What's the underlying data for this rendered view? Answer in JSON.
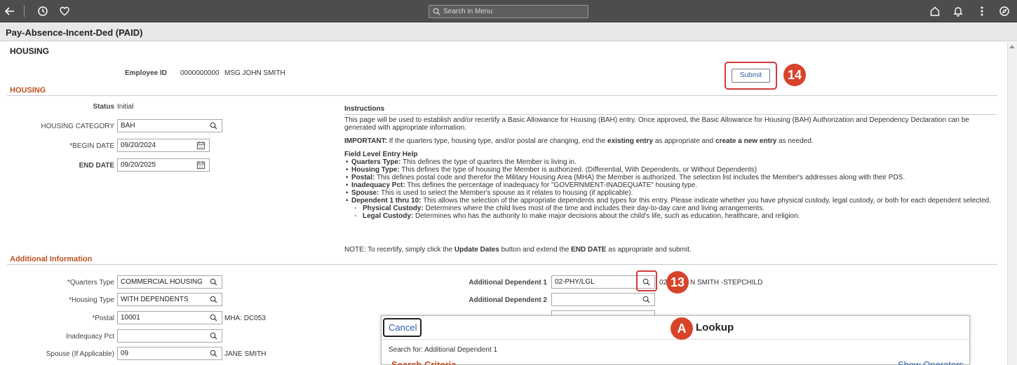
{
  "topbar": {
    "search_placeholder": "Search in Menu"
  },
  "page": {
    "title": "Pay-Absence-Incent-Ded (PAID)",
    "content_title": "HOUSING"
  },
  "employee": {
    "id_label": "Employee ID",
    "id_value": "0000000000",
    "name": "MSG JOHN SMITH"
  },
  "submit_label": "Submit",
  "badges": {
    "b14": "14",
    "b13": "13",
    "bA": "A"
  },
  "housing": {
    "section_title": "HOUSING",
    "status_label": "Status",
    "status_value": "Initial",
    "category_label": "HOUSING CATEGORY",
    "category_value": "BAH",
    "begin_label": "*BEGIN DATE",
    "begin_value": "09/20/2024",
    "end_label": "END DATE",
    "end_value": "09/20/2025"
  },
  "instructions": {
    "title": "Instructions",
    "p1": "This page will be used to establish and/or recertify a Basic Allowance for Housing (BAH) entry. Once approved, the Basic Allowance for Housing (BAH) Authorization and Dependency Declaration can be generated with appropriate information.",
    "important_label": "IMPORTANT:",
    "important_text1": " If the quarters type, housing type, and/or postal are changing, end the ",
    "important_bold1": "existing entry",
    "important_text2": " as appropriate and ",
    "important_bold2": "create a new entry",
    "important_text3": " as needed.",
    "help_title": "Field Level Entry Help",
    "items": [
      {
        "b": "Quarters Type:",
        "t": " This defines the type of quarters the Member is living in."
      },
      {
        "b": "Housing Type:",
        "t": " This defines the type of housing the Member is authorized. (Differential, With Dependents, or Without Dependents)"
      },
      {
        "b": "Postal:",
        "t": " This defines postal code and therefor the Military Housing Area (MHA) the Member is authorized. The selection list includes the Member's addresses along with their PDS."
      },
      {
        "b": "Inadequacy Pct:",
        "t": " This defines the percentage of inadequacy for \"GOVERNMENT-INADEQUATE\" housing type."
      },
      {
        "b": "Spouse:",
        "t": " This is used to select the Member's spouse as it relates to housing (if applicable)."
      },
      {
        "b": "Dependent 1 thru 10:",
        "t": " This allows the selection of the appropriate dependents and types for this entry. Please indicate whether you have physical custody, legal custody, or both for each dependent selected."
      }
    ],
    "subitems": [
      {
        "b": "Physical Custody:",
        "t": " Determines where the child lives most of the time and includes their day-to-day care and living arrangements."
      },
      {
        "b": "Legal Custody:",
        "t": " Determines who has the authority to make major decisions about the child's life, such as education, healthcare, and religion."
      }
    ],
    "note_text1": "NOTE: To recertify, simply click the ",
    "note_bold1": "Update Dates",
    "note_text2": " button and extend the ",
    "note_bold2": "END DATE",
    "note_text3": " as appropriate and submit."
  },
  "additional": {
    "section_title": "Additional Information",
    "quarters_label": "*Quarters Type",
    "quarters_value": "COMMERCIAL HOUSING",
    "housing_type_label": "*Housing Type",
    "housing_type_value": "WITH DEPENDENTS",
    "postal_label": "*Postal",
    "postal_value": "10001",
    "postal_mha": "MHA: DC053",
    "inadequacy_label": "Inadequacy Pct",
    "inadequacy_value": "",
    "spouse_label": "Spouse (If Applicable)",
    "spouse_value": "09",
    "spouse_name": "JANE SMITH",
    "dep1_label": "Additional Dependent 1",
    "dep1_value": "02-PHY/LGL",
    "dep1_desc_prefix": "02",
    "dep1_desc": "N SMITH   -STEPCHILD",
    "dep2_label": "Additional Dependent 2",
    "dep2_value": ""
  },
  "lookup": {
    "cancel_label": "Cancel",
    "title": "Lookup",
    "search_for": "Search for:  Additional Dependent 1",
    "criteria": "Search Criteria",
    "show_operators": "Show Operators"
  }
}
